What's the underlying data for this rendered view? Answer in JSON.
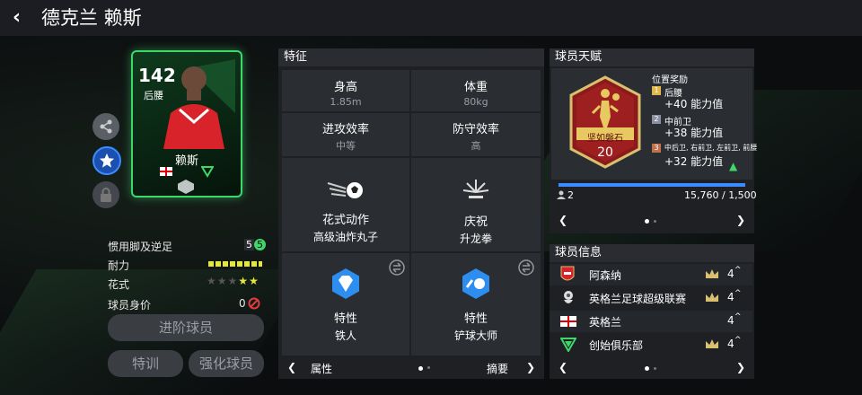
{
  "header": {
    "title": "德克兰 赖斯"
  },
  "card": {
    "rating": "142",
    "position": "后腰",
    "name": "赖斯"
  },
  "left_stats": {
    "weak_foot_label": "惯用脚及逆足",
    "weak_foot_value": "5",
    "weak_foot_value2": "5",
    "stamina_label": "耐力",
    "skill_label": "花式",
    "skill_stars_filled": 2,
    "skill_stars_total": 5,
    "value_label": "球员身价",
    "value": "0"
  },
  "buttons": {
    "advance": "进阶球员",
    "train": "特训",
    "strengthen": "强化球员"
  },
  "traits": {
    "header": "特征",
    "height_label": "身高",
    "height_value": "1.85m",
    "weight_label": "体重",
    "weight_value": "80kg",
    "att_label": "进攻效率",
    "att_value": "中等",
    "def_label": "防守效率",
    "def_value": "高",
    "skill_move_label": "花式动作",
    "skill_move_value": "高级油炸丸子",
    "celebration_label": "庆祝",
    "celebration_value": "升龙拳",
    "trait1_label": "特性",
    "trait1_value": "铁人",
    "trait2_label": "特性",
    "trait2_value": "铲球大师",
    "footer_left": "属性",
    "footer_right": "摘要"
  },
  "talent": {
    "header": "球员天赋",
    "badge_name": "坚如磐石",
    "badge_level": "20",
    "bonus_title": "位置奖励",
    "bonuses": [
      {
        "rank": "1",
        "pos": "后腰",
        "value": "+40 能力值",
        "color": "#e0b84a"
      },
      {
        "rank": "2",
        "pos": "中前卫",
        "value": "+38 能力值",
        "color": "#8a90a0"
      },
      {
        "rank": "3",
        "pos": "中后卫, 右前卫, 左前卫, 前腰",
        "value": "+32 能力值",
        "color": "#c0704a"
      }
    ],
    "progress_count": "2",
    "progress_text": "15,760 / 1,500",
    "progress_fraction": 1.0
  },
  "info": {
    "header": "球员信息",
    "rows": [
      {
        "text": "阿森纳",
        "num": "4",
        "crown": true
      },
      {
        "text": "英格兰足球超级联赛",
        "num": "4",
        "crown": true
      },
      {
        "text": "英格兰",
        "num": "4",
        "crown": false
      },
      {
        "text": "创始俱乐部",
        "num": "4",
        "crown": true
      }
    ]
  },
  "icons": {
    "back": "back-arrow-icon",
    "share": "share-icon",
    "favorite": "star-icon",
    "lock": "lock-icon",
    "ban": "ban-icon",
    "swap": "swap-icon",
    "crown": "crown-icon"
  },
  "colors": {
    "accent_green": "#3fd66a",
    "stamina": "#e5e83a",
    "star_filled": "#e5e83a",
    "progress": "#3a8cff"
  }
}
